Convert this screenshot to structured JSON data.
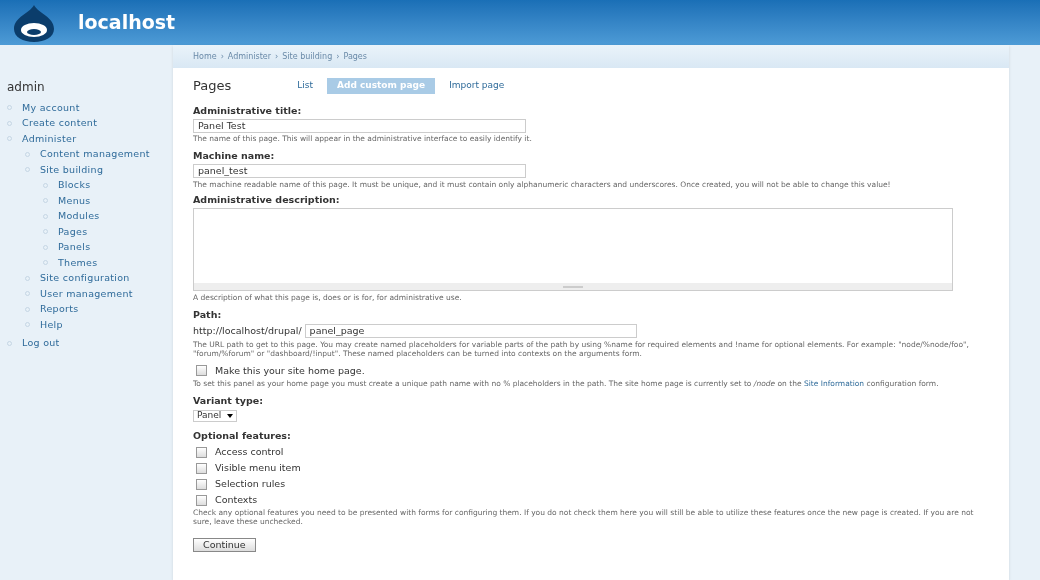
{
  "site": {
    "name": "localhost"
  },
  "breadcrumb": [
    "Home",
    "Administer",
    "Site building",
    "Pages"
  ],
  "breadcrumb_separator": "›",
  "sidebar": {
    "title": "admin",
    "items": [
      {
        "label": "My account"
      },
      {
        "label": "Create content"
      },
      {
        "label": "Administer",
        "children": [
          {
            "label": "Content management"
          },
          {
            "label": "Site building",
            "children": [
              {
                "label": "Blocks"
              },
              {
                "label": "Menus"
              },
              {
                "label": "Modules"
              },
              {
                "label": "Pages"
              },
              {
                "label": "Panels"
              },
              {
                "label": "Themes"
              }
            ]
          },
          {
            "label": "Site configuration"
          },
          {
            "label": "User management"
          },
          {
            "label": "Reports"
          },
          {
            "label": "Help"
          }
        ]
      },
      {
        "label": "Log out"
      }
    ]
  },
  "page": {
    "title": "Pages",
    "tabs": [
      {
        "label": "List",
        "selected": false
      },
      {
        "label": "Add custom page",
        "selected": true
      },
      {
        "label": "Import page",
        "selected": false
      }
    ]
  },
  "form": {
    "admin_title": {
      "label": "Administrative title:",
      "value": "Panel Test",
      "help": "The name of this page. This will appear in the administrative interface to easily identify it."
    },
    "machine_name": {
      "label": "Machine name:",
      "value": "panel_test",
      "help": "The machine readable name of this page. It must be unique, and it must contain only alphanumeric characters and underscores. Once created, you will not be able to change this value!"
    },
    "description": {
      "label": "Administrative description:",
      "help": "A description of what this page is, does or is for, for administrative use."
    },
    "path": {
      "label": "Path:",
      "prefix": "http://localhost/drupal/",
      "value": "panel_page",
      "help": "The URL path to get to this page. You may create named placeholders for variable parts of the path by using %name for required elements and !name for optional elements. For example: \"node/%node/foo\", \"forum/%forum\" or \"dashboard/!input\". These named placeholders can be turned into contexts on the arguments form."
    },
    "home_page": {
      "label": "Make this your site home page.",
      "checked": false,
      "help_before": "To set this panel as your home page you must create a unique path name with no % placeholders in the path. The site home page is currently set to */node* on the",
      "link": "Site Information",
      "help_after": "configuration form."
    },
    "variant": {
      "label": "Variant type:",
      "value": "Panel"
    },
    "features": {
      "label": "Optional features:",
      "options": [
        {
          "label": "Access control",
          "checked": false
        },
        {
          "label": "Visible menu item",
          "checked": false
        },
        {
          "label": "Selection rules",
          "checked": false
        },
        {
          "label": "Contexts",
          "checked": false
        }
      ],
      "help": "Check any optional features you need to be presented with forms for configuring them. If you do not check them here you will still be able to utilize these features once the new page is created. If you are not sure, leave these unchecked."
    },
    "submit": "Continue"
  }
}
